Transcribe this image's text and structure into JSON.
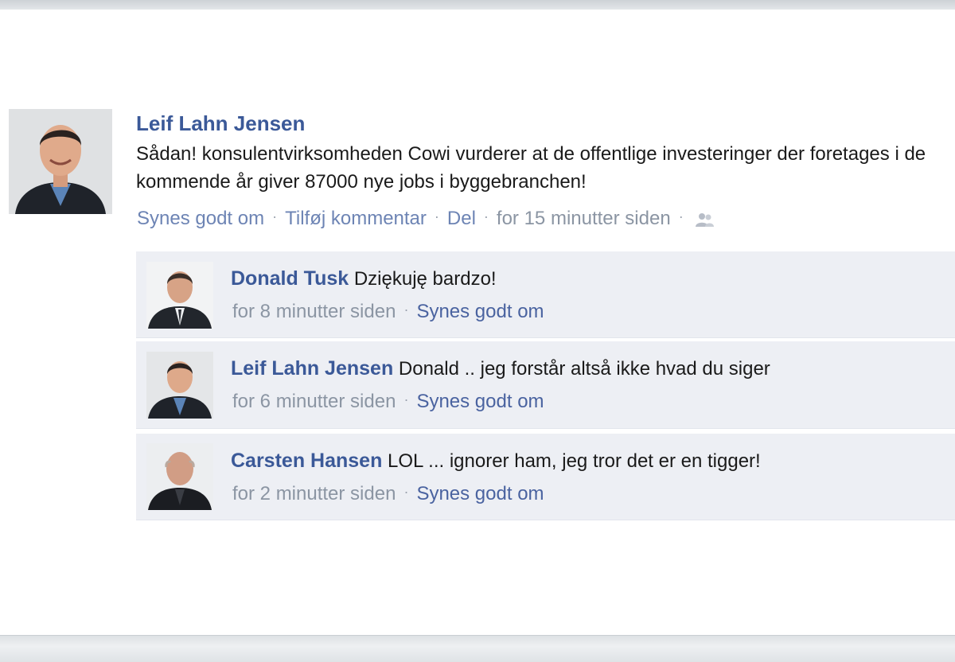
{
  "post": {
    "author": "Leif Lahn Jensen",
    "text": "Sådan! konsulentvirksomheden Cowi vurderer at de offentlige investeringer der foretages i de kommende år giver 87000 nye jobs i byggebranchen!",
    "like_label": "Synes godt om",
    "comment_label": "Tilføj kommentar",
    "share_label": "Del",
    "timestamp": "for 15 minutter siden",
    "audience_icon": "friends-icon"
  },
  "comments": [
    {
      "author": "Donald Tusk",
      "text": "Dziękuję bardzo!",
      "timestamp": "for 8 minutter siden",
      "like_label": "Synes godt om"
    },
    {
      "author": "Leif Lahn Jensen",
      "text": "Donald .. jeg forstår altså ikke hvad du siger",
      "timestamp": "for 6 minutter siden",
      "like_label": "Synes godt om"
    },
    {
      "author": "Carsten Hansen",
      "text": "LOL ... ignorer ham, jeg tror det er en tigger!",
      "timestamp": "for 2 minutter siden",
      "like_label": "Synes godt om"
    }
  ],
  "colors": {
    "link": "#3b5998",
    "action_link": "#6d84b4",
    "comment_bg": "#edeff4",
    "meta": "#8b95a3"
  }
}
